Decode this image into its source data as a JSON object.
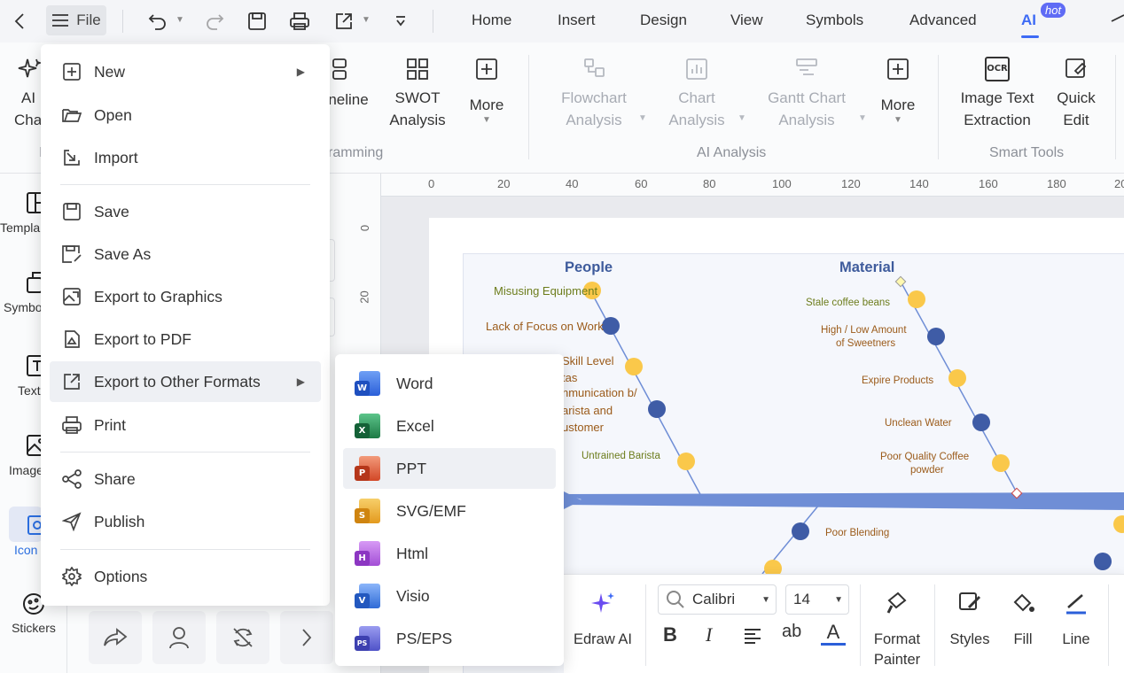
{
  "topbar": {
    "file_label": "File",
    "tabs": [
      "Home",
      "Insert",
      "Design",
      "View",
      "Symbols",
      "Advanced",
      "AI"
    ],
    "ai_badge": "hot",
    "active_tab": "AI",
    "accent": "#3d6af5"
  },
  "ribbon": {
    "left_items": [
      "AI",
      "Cha"
    ],
    "timeline_label": "neline",
    "swot": [
      "SWOT",
      "Analysis"
    ],
    "more_label": "More",
    "diagramming_group": "ramming",
    "ai_analysis": {
      "flowchart": [
        "Flowchart",
        "Analysis"
      ],
      "chart": [
        "Chart",
        "Analysis"
      ],
      "gantt": [
        "Gantt Chart",
        "Analysis"
      ],
      "more": "More",
      "group": "AI Analysis"
    },
    "smart_tools": {
      "image_text": [
        "Image Text",
        "Extraction"
      ],
      "quick_edit": [
        "Quick",
        "Edit"
      ],
      "group": "Smart Tools",
      "ocr": "OCR"
    },
    "left_group_fragment": "I"
  },
  "sidebar": {
    "items": [
      "Templa",
      "Symbo",
      "Text",
      "Image",
      "Icon",
      "Stickers"
    ],
    "active": "Icon"
  },
  "ruler": {
    "h_ticks": [
      "0",
      "20",
      "40",
      "60",
      "80",
      "100",
      "120",
      "140",
      "160",
      "180",
      "20"
    ],
    "v_ticks": [
      "0",
      "20"
    ]
  },
  "diagram": {
    "people": "People",
    "material": "Material",
    "people_causes": [
      "Misusing Equipment",
      "Lack of Focus on Work",
      "Skill Level",
      "tas",
      "nmunication b/",
      "arista and",
      "ustomer",
      "Untrained Barista"
    ],
    "material_causes": [
      "Stale coffee beans",
      "High / Low Amount",
      "of Sweetners",
      "Expire Products",
      "Unclean Water",
      "Poor Quality Coffee",
      "powder"
    ],
    "lower_cause": "Poor Blending"
  },
  "file_menu": {
    "items": [
      "New",
      "Open",
      "Import",
      "Save",
      "Save As",
      "Export to Graphics",
      "Export to PDF",
      "Export to Other Formats",
      "Print",
      "Share",
      "Publish",
      "Options"
    ]
  },
  "export_submenu": {
    "items": [
      {
        "label": "Word",
        "badge": "W",
        "color": "#2b5fd9"
      },
      {
        "label": "Excel",
        "badge": "X",
        "color": "#1d7a45"
      },
      {
        "label": "PPT",
        "badge": "P",
        "color": "#d24726"
      },
      {
        "label": "SVG/EMF",
        "badge": "S",
        "color": "#e39a1e"
      },
      {
        "label": "Html",
        "badge": "H",
        "color": "#a34fd6"
      },
      {
        "label": "Visio",
        "badge": "V",
        "color": "#2f6bd6"
      },
      {
        "label": "PS/EPS",
        "badge": "PS",
        "color": "#4f52c8"
      }
    ],
    "hovered": "PPT"
  },
  "float_toolbar": {
    "edraw_ai": "Edraw AI",
    "font": "Calibri",
    "font_size": "14",
    "format_painter": [
      "Format",
      "Painter"
    ],
    "styles": "Styles",
    "fill": "Fill",
    "line": "Line",
    "text_case": "ab"
  }
}
